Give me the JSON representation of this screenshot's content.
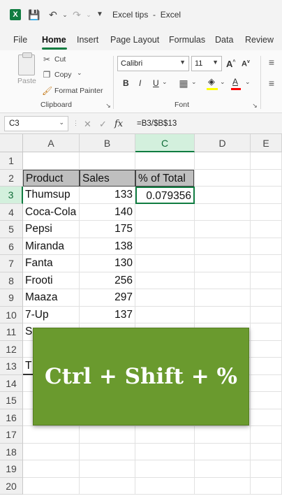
{
  "window": {
    "title": "Excel tips",
    "app": "Excel",
    "app_icon": "excel-logo"
  },
  "menu": {
    "tabs": [
      "File",
      "Home",
      "Insert",
      "Page Layout",
      "Formulas",
      "Data",
      "Review"
    ],
    "active_tab": "Home"
  },
  "ribbon": {
    "clipboard": {
      "paste_label": "Paste",
      "cut_label": "Cut",
      "copy_label": "Copy",
      "format_painter_label": "Format Painter",
      "group_label": "Clipboard"
    },
    "font": {
      "font_name": "Calibri",
      "font_size": "11",
      "bold": "B",
      "italic": "I",
      "underline": "U",
      "group_label": "Font",
      "highlight_color": "#ffff00",
      "font_color": "#ff0000"
    }
  },
  "formula_bar": {
    "name_box": "C3",
    "fx": "fx",
    "formula": "=B3/$B$13"
  },
  "sheet": {
    "columns": [
      "A",
      "B",
      "C",
      "D",
      "E"
    ],
    "selected_column": "C",
    "rows": [
      "1",
      "2",
      "3",
      "4",
      "5",
      "6",
      "7",
      "8",
      "9",
      "10",
      "11",
      "12",
      "13",
      "14",
      "15",
      "16",
      "17",
      "18",
      "19",
      "20"
    ],
    "selected_row": "3",
    "header_row": {
      "product": "Product",
      "sales": "Sales",
      "pct": "% of Total"
    },
    "data": [
      {
        "product": "Thumsup",
        "sales": "133",
        "pct": "0.079356"
      },
      {
        "product": "Coca-Cola",
        "sales": "140",
        "pct": ""
      },
      {
        "product": "Pepsi",
        "sales": "175",
        "pct": ""
      },
      {
        "product": "Miranda",
        "sales": "138",
        "pct": ""
      },
      {
        "product": "Fanta",
        "sales": "130",
        "pct": ""
      },
      {
        "product": "Frooti",
        "sales": "256",
        "pct": ""
      },
      {
        "product": "Maaza",
        "sales": "297",
        "pct": ""
      },
      {
        "product": "7-Up",
        "sales": "137",
        "pct": ""
      }
    ],
    "partial_a11": "S",
    "partial_a13": "T"
  },
  "overlay": {
    "text": "Ctrl + Shift + %",
    "color": "#6a9a2e"
  }
}
